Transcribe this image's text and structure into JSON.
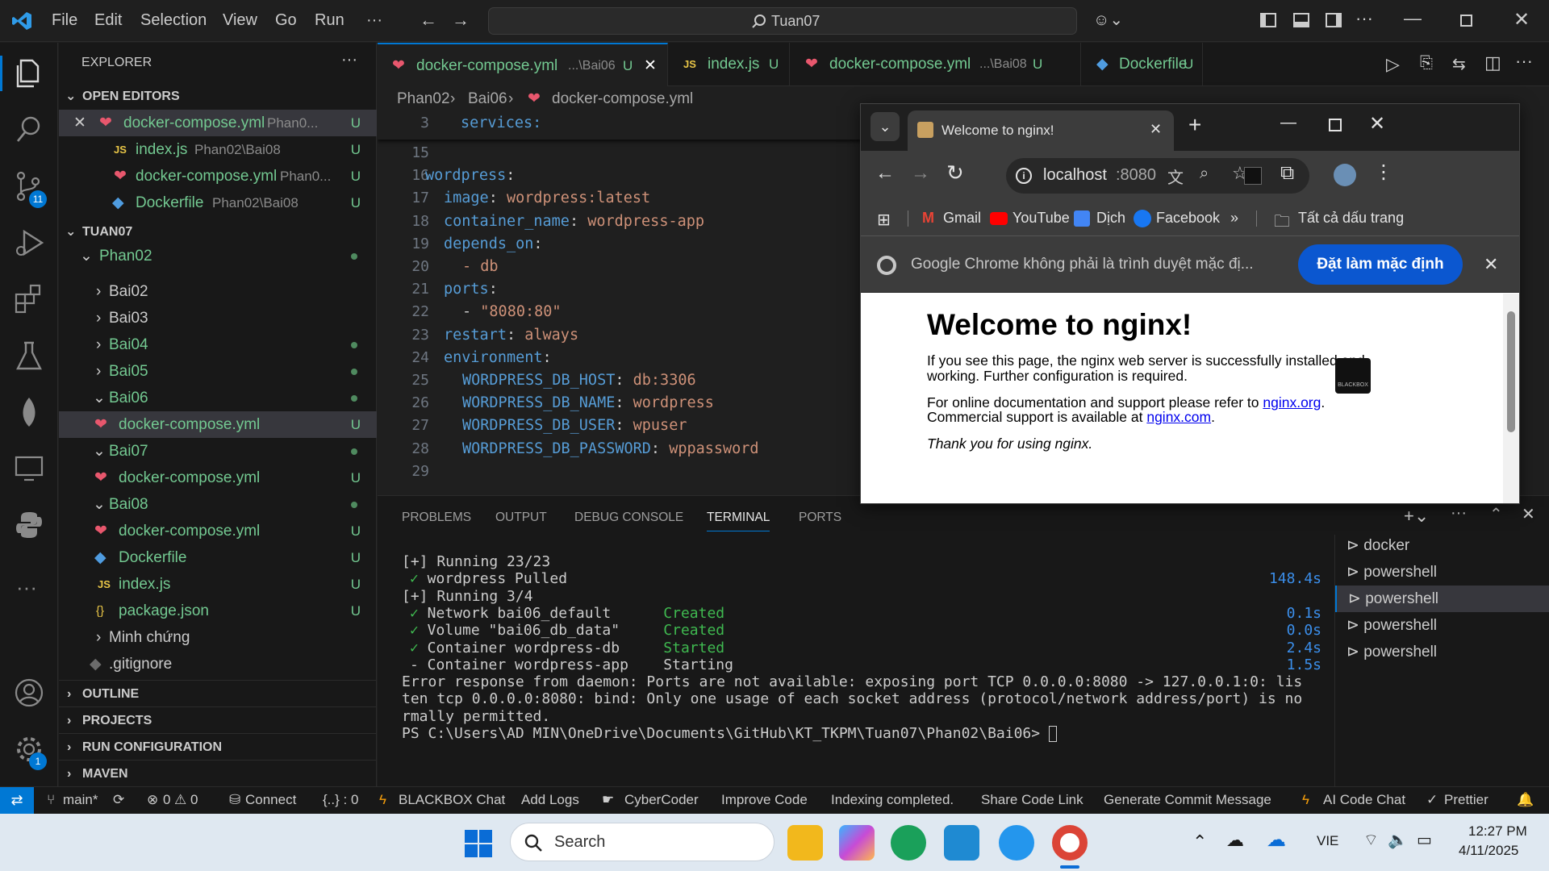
{
  "titlebar": {
    "menus": [
      "File",
      "Edit",
      "Selection",
      "View",
      "Go",
      "Run",
      "···"
    ],
    "command_center": "Tuan07"
  },
  "activity": {
    "scm_badge": "11",
    "settings_badge": "1"
  },
  "sidebar": {
    "title": "EXPLORER",
    "open_editors_label": "OPEN EDITORS",
    "open_editors": [
      {
        "name": "docker-compose.yml",
        "path": "Phan0...",
        "status": "U"
      },
      {
        "name": "index.js",
        "path": "Phan02\\Bai08",
        "status": "U"
      },
      {
        "name": "docker-compose.yml",
        "path": "Phan0...",
        "status": "U"
      },
      {
        "name": "Dockerfile",
        "path": "Phan02\\Bai08",
        "status": "U"
      }
    ],
    "workspace_label": "TUAN07",
    "tree": {
      "phan02": "Phan02",
      "bai02": "Bai02",
      "bai03": "Bai03",
      "bai04": "Bai04",
      "bai05": "Bai05",
      "bai06": "Bai06",
      "bai06_compose": "docker-compose.yml",
      "bai07": "Bai07",
      "bai07_compose": "docker-compose.yml",
      "bai08": "Bai08",
      "bai08_compose": "docker-compose.yml",
      "bai08_dockerfile": "Dockerfile",
      "bai08_index": "index.js",
      "bai08_package": "package.json",
      "minh_chung": "Minh chứng",
      "gitignore": ".gitignore",
      "status_u": "U"
    },
    "sections": [
      "OUTLINE",
      "PROJECTS",
      "RUN CONFIGURATION",
      "MAVEN"
    ]
  },
  "tabs": [
    {
      "label": "docker-compose.yml",
      "path": "...\\Bai06",
      "status": "U"
    },
    {
      "label": "index.js",
      "status": "U"
    },
    {
      "label": "docker-compose.yml",
      "path": "...\\Bai08",
      "status": "U"
    },
    {
      "label": "Dockerfile",
      "status": "U"
    }
  ],
  "breadcrumb": [
    "Phan02",
    "Bai06",
    "docker-compose.yml"
  ],
  "editor": {
    "sticky": {
      "line": "3",
      "text": "services:"
    },
    "lines": [
      {
        "n": "15",
        "key": "",
        "val": ""
      },
      {
        "n": "16",
        "indent": 1,
        "key": "wordpress",
        "val": ""
      },
      {
        "n": "17",
        "indent": 2,
        "key": "image",
        "val": "wordpress:latest"
      },
      {
        "n": "18",
        "indent": 2,
        "key": "container_name",
        "val": "wordpress-app"
      },
      {
        "n": "19",
        "indent": 2,
        "key": "depends_on",
        "val": ""
      },
      {
        "n": "20",
        "indent": 3,
        "key": "- db",
        "val": ""
      },
      {
        "n": "21",
        "indent": 2,
        "key": "ports",
        "val": ""
      },
      {
        "n": "22",
        "indent": 3,
        "key": "- ",
        "val": "\"8080:80\""
      },
      {
        "n": "23",
        "indent": 2,
        "key": "restart",
        "val": "always"
      },
      {
        "n": "24",
        "indent": 2,
        "key": "environment",
        "val": ""
      },
      {
        "n": "25",
        "indent": 3,
        "key": "WORDPRESS_DB_HOST",
        "val": "db:3306"
      },
      {
        "n": "26",
        "indent": 3,
        "key": "WORDPRESS_DB_NAME",
        "val": "wordpress"
      },
      {
        "n": "27",
        "indent": 3,
        "key": "WORDPRESS_DB_USER",
        "val": "wpuser"
      },
      {
        "n": "28",
        "indent": 3,
        "key": "WORDPRESS_DB_PASSWORD",
        "val": "wppassword"
      },
      {
        "n": "29",
        "key": "",
        "val": ""
      }
    ]
  },
  "panel": {
    "tabs": [
      "PROBLEMS",
      "OUTPUT",
      "DEBUG CONSOLE",
      "TERMINAL",
      "PORTS"
    ],
    "active_tab": "TERMINAL",
    "terminal": [
      {
        "text": "[+] Running 23/23"
      },
      {
        "tick": "✓",
        "text": " wordpress Pulled",
        "time": "148.4s"
      },
      {
        "text": "[+] Running 3/4"
      },
      {
        "tick": "✓",
        "text": " Network bai06_default      ",
        "state": "Created",
        "time": "0.1s"
      },
      {
        "tick": "✓",
        "text": " Volume \"bai06_db_data\"     ",
        "state": "Created",
        "time": "0.0s"
      },
      {
        "tick": "✓",
        "text": " Container wordpress-db     ",
        "state": "Started",
        "time": "2.4s"
      },
      {
        "tick": "-",
        "text": " Container wordpress-app    Starting",
        "time": "1.5s"
      },
      {
        "text": "Error response from daemon: Ports are not available: exposing port TCP 0.0.0.0:8080 -> 127.0.0.1:0: lis"
      },
      {
        "text": "ten tcp 0.0.0.0:8080: bind: Only one usage of each socket address (protocol/network address/port) is no"
      },
      {
        "text": "rmally permitted."
      },
      {
        "text": "PS C:\\Users\\AD MIN\\OneDrive\\Documents\\GitHub\\KT_TKPM\\Tuan07\\Phan02\\Bai06> "
      }
    ],
    "terminal_list": [
      "docker",
      "powershell",
      "powershell",
      "powershell",
      "powershell"
    ]
  },
  "chrome": {
    "tab_title": "Welcome to nginx!",
    "url_host": "localhost",
    "url_port": ":8080",
    "bookmarks": [
      "Gmail",
      "YouTube",
      "Dịch",
      "Facebook",
      "»",
      "Tất cả dấu trang"
    ],
    "infobar_text": "Google Chrome không phải là trình duyệt mặc đị...",
    "infobar_button": "Đặt làm mặc định",
    "page": {
      "heading": "Welcome to nginx!",
      "p1a": "If you see this page, the nginx web server is successfully installed and",
      "p1b": "working. Further configuration is required.",
      "p2a": "For online documentation and support please refer to ",
      "link1": "nginx.org",
      "p2b": "Commercial support is available at ",
      "link2": "nginx.com",
      "p3": "Thank you for using nginx.",
      "badge": "BLACKBOX"
    }
  },
  "statusbar": {
    "branch": "main*",
    "errors": "0",
    "warnings": "0",
    "connect": "Connect",
    "braces": "{..} : 0",
    "items": [
      "BLACKBOX Chat",
      "Add Logs",
      "CyberCoder",
      "Improve Code",
      "Indexing completed.",
      "Share Code Link",
      "Generate Commit Message",
      "AI Code Chat",
      "Prettier"
    ]
  },
  "taskbar": {
    "search": "Search",
    "lang": "VIE",
    "time": "12:27 PM",
    "date": "4/11/2025"
  },
  "colors": {
    "accent": "#0078d4",
    "git_untracked": "#73c991",
    "yaml_key": "#569cd6",
    "yaml_value": "#ce9178",
    "chrome_button": "#0b57d0"
  }
}
